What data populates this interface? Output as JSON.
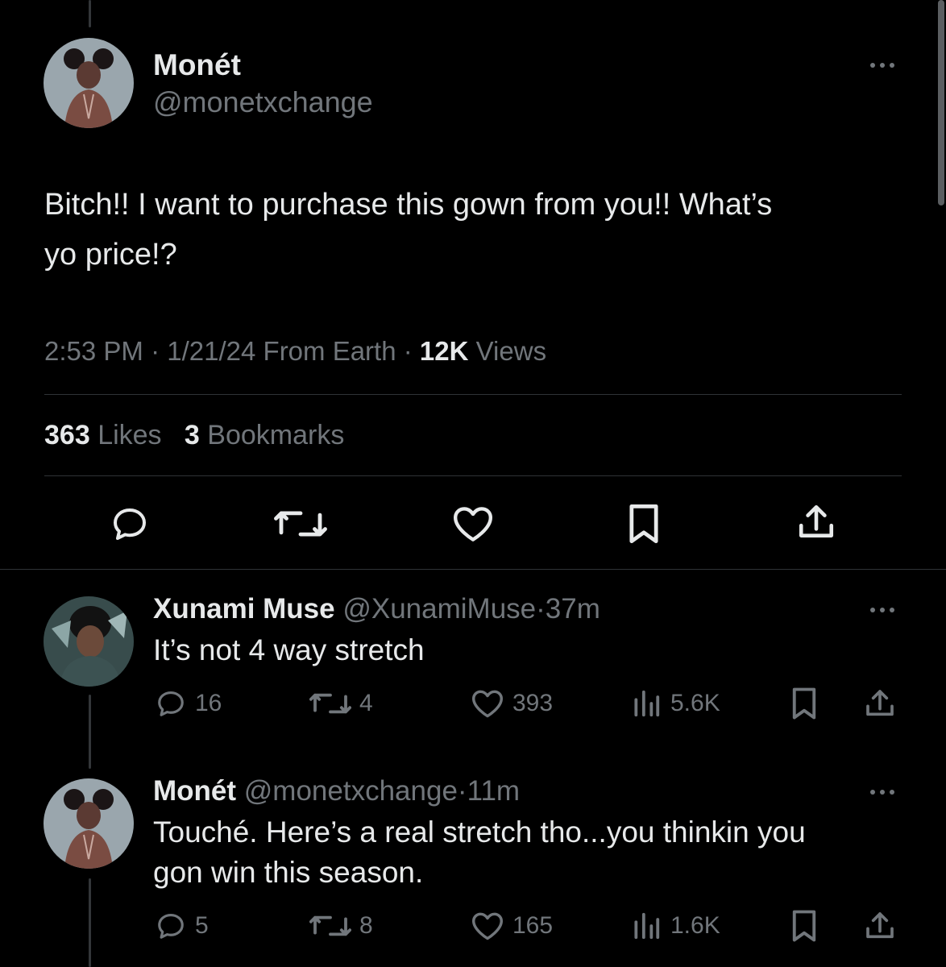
{
  "main_tweet": {
    "author_name": "Monét",
    "handle": "@monetxchange",
    "text_line1": "Bitch!! I want to purchase this gown from you!! What’s",
    "text_line2": "yo price!?",
    "time": "2:53 PM",
    "dot1": "·",
    "date": "1/21/24",
    "source": "From Earth",
    "dot2": "·",
    "views_count": "12K",
    "views_label": "Views",
    "likes_count": "363",
    "likes_label": "Likes",
    "bookmarks_count": "3",
    "bookmarks_label": "Bookmarks"
  },
  "replies": [
    {
      "author_name": "Xunami Muse",
      "handle": "@XunamiMuse",
      "dot": "·",
      "time": "37m",
      "text_line1": "It’s not 4 way stretch",
      "text_line2": "",
      "replies": "16",
      "retweets": "4",
      "likes": "393",
      "views": "5.6K"
    },
    {
      "author_name": "Monét",
      "handle": "@monetxchange",
      "dot": "·",
      "time": "11m",
      "text_line1": "Touché. Here’s a real stretch tho...you thinkin you",
      "text_line2": "gon win this season.",
      "replies": "5",
      "retweets": "8",
      "likes": "165",
      "views": "1.6K"
    }
  ],
  "icons": {
    "reply": "speech-bubble-icon",
    "retweet": "retweet-arrows-icon",
    "like": "heart-icon",
    "bookmark": "bookmark-icon",
    "share": "share-upload-icon",
    "views": "bar-chart-icon",
    "more": "more-dots-icon"
  },
  "colors": {
    "background": "#000000",
    "text": "#e7e9ea",
    "secondary": "#71767b",
    "divider": "#2f3336"
  }
}
